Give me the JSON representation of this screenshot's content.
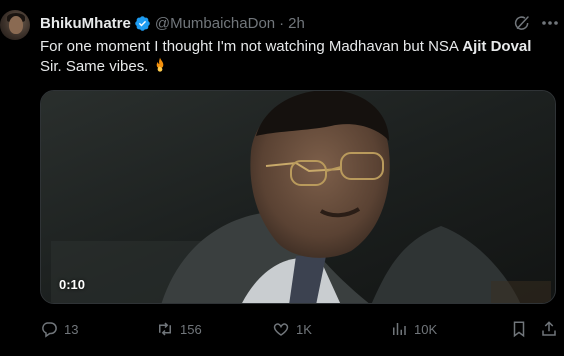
{
  "tweet": {
    "author_name": "BhikuMhatre",
    "handle": "@MumbaichaDon",
    "separator": "·",
    "time": "2h",
    "text_before_bold": "For one moment I thought I'm not watching Madhavan but NSA ",
    "text_bold": "Ajit Doval",
    "text_after_bold": " Sir. Same vibes.",
    "emoji_icon": "fire-emoji-icon"
  },
  "media": {
    "timecode": "0:10"
  },
  "actions": {
    "replies": "13",
    "reposts": "156",
    "likes": "1K",
    "views": "10K"
  },
  "colors": {
    "background": "#000000",
    "text": "#e7e9ea",
    "muted": "#71767b",
    "verified": "#1d9bf0"
  }
}
